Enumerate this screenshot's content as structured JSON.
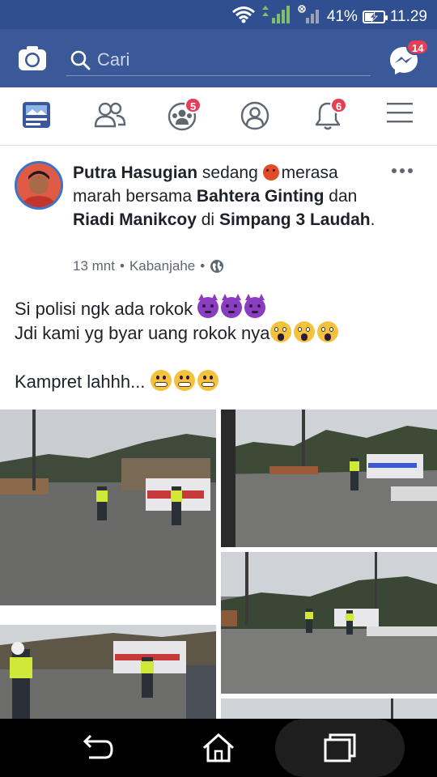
{
  "status_bar": {
    "battery_percent_text": "41%",
    "battery_level": 0.41,
    "time": "11.29"
  },
  "header": {
    "search_placeholder": "Cari",
    "messenger_badge": "14"
  },
  "nav": {
    "groups_badge": "5",
    "notifications_badge": "6"
  },
  "post": {
    "author": "Putra Hasugian",
    "activity_prefix": "sedang",
    "feeling": "merasa marah",
    "with_word": "bersama",
    "tagged_1": "Bahtera Ginting",
    "and_word": "dan",
    "tagged_2": "Riadi Manikcoy",
    "at_word": "di",
    "location": "Simpang 3 Laudah",
    "time_ago": "13 mnt",
    "place": "Kabanjahe",
    "lines": [
      "Si polisi ngk ada rokok",
      "Jdi kami yg byar uang rokok nya",
      "Kampret lahhh..."
    ]
  },
  "colors": {
    "brand": "#3b5998",
    "status_bar": "#2f4f90",
    "badge": "#e53f55"
  },
  "icons": [
    "camera-icon",
    "search-icon",
    "messenger-icon",
    "news-feed-icon",
    "friends-icon",
    "groups-icon",
    "profile-icon",
    "notifications-icon",
    "menu-icon",
    "globe-icon",
    "back-icon",
    "home-icon",
    "recent-apps-icon"
  ]
}
